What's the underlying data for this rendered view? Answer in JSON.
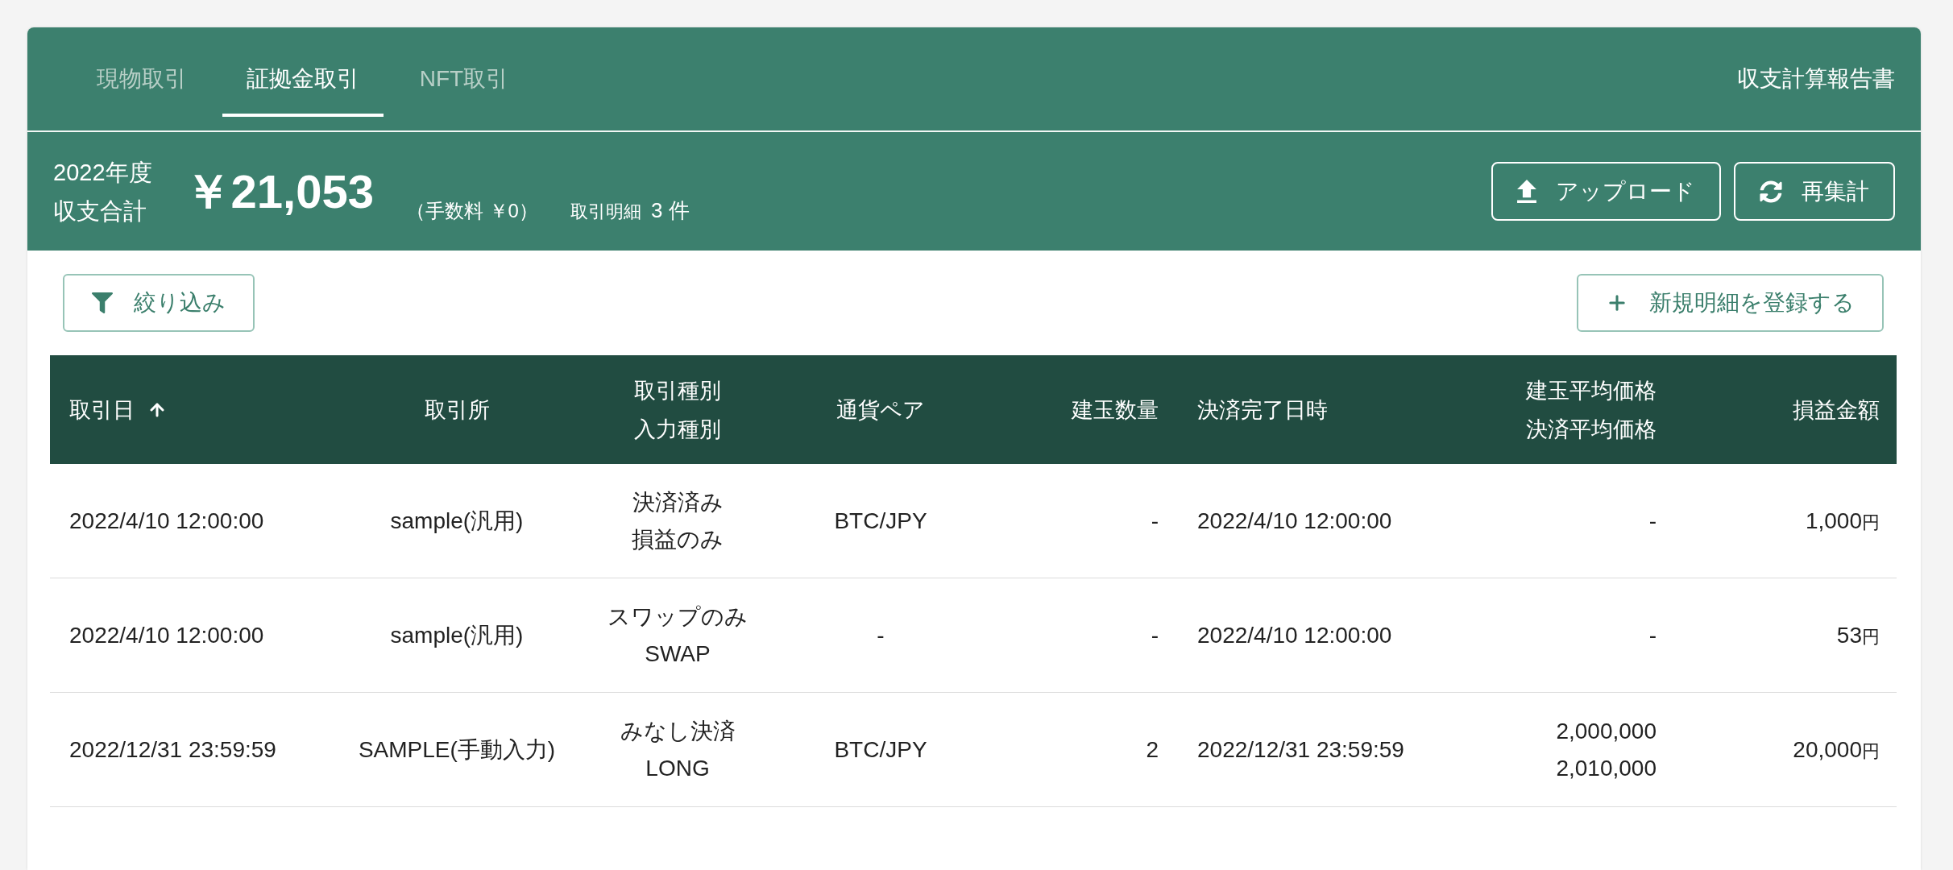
{
  "tabs": [
    {
      "label": "現物取引",
      "selected": false
    },
    {
      "label": "証拠金取引",
      "selected": true
    },
    {
      "label": "NFT取引",
      "selected": false
    }
  ],
  "report_link": "収支計算報告書",
  "summary": {
    "period": "2022年度",
    "title": "収支合計",
    "total": "￥21,053",
    "fee": "（手数料 ￥0）",
    "count_label": "取引明細",
    "count": "3 件"
  },
  "header_buttons": [
    {
      "kind": "upload",
      "label": "アップロード"
    },
    {
      "kind": "refresh",
      "label": "再集計"
    }
  ],
  "toolbar": [
    {
      "kind": "filter",
      "label": "絞り込み"
    },
    {
      "kind": "add",
      "label": "新規明細を登録する"
    }
  ],
  "table": {
    "columns": [
      {
        "label": [
          "取引日"
        ],
        "sorted": true
      },
      {
        "label": [
          "取引所"
        ],
        "sorted": false
      },
      {
        "label": [
          "取引種別",
          "入力種別"
        ],
        "sorted": false
      },
      {
        "label": [
          "通貨ペア"
        ],
        "sorted": false
      },
      {
        "label": [
          "建玉数量"
        ],
        "sorted": false
      },
      {
        "label": [
          "決済完了日時"
        ],
        "sorted": false
      },
      {
        "label": [
          "建玉平均価格",
          "決済平均価格"
        ],
        "sorted": false
      },
      {
        "label": [
          "損益金額"
        ],
        "sorted": false
      }
    ],
    "rows": [
      {
        "date": "2022/4/10 12:00:00",
        "exchange": "sample(汎用)",
        "trade_type": "決済済み",
        "input_type": "損益のみ",
        "pair": "BTC/JPY",
        "quantity": "-",
        "settled_at": "2022/4/10 12:00:00",
        "avg_prices": [
          "-"
        ],
        "profit": "1,000",
        "profit_unit": "円"
      },
      {
        "date": "2022/4/10 12:00:00",
        "exchange": "sample(汎用)",
        "trade_type": "スワップのみ",
        "input_type": "SWAP",
        "pair": "-",
        "quantity": "-",
        "settled_at": "2022/4/10 12:00:00",
        "avg_prices": [
          "-"
        ],
        "profit": "53",
        "profit_unit": "円"
      },
      {
        "date": "2022/12/31 23:59:59",
        "exchange": "SAMPLE(手動入力)",
        "trade_type": "みなし決済",
        "input_type": "LONG",
        "pair": "BTC/JPY",
        "quantity": "2",
        "settled_at": "2022/12/31 23:59:59",
        "avg_prices": [
          "2,000,000",
          "2,010,000"
        ],
        "profit": "20,000",
        "profit_unit": "円"
      }
    ]
  }
}
